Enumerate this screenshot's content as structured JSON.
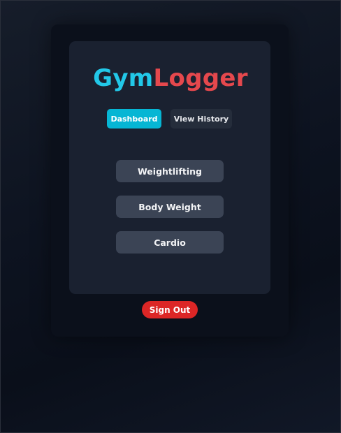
{
  "app": {
    "title_part1": "Gym",
    "title_part2": "Logger"
  },
  "nav": {
    "tabs": [
      {
        "label": "Dashboard",
        "active": true
      },
      {
        "label": "View History",
        "active": false
      }
    ]
  },
  "workouts": {
    "buttons": [
      {
        "label": "Weightlifting"
      },
      {
        "label": "Body Weight"
      },
      {
        "label": "Cardio"
      }
    ]
  },
  "account": {
    "signout_label": "Sign Out"
  },
  "colors": {
    "accent_cyan": "#06b6d4",
    "title_cyan": "#22c8e8",
    "title_red": "#e5484d",
    "signout_red": "#dc2626",
    "card_bg": "#1a2130",
    "button_bg": "#3b4455"
  }
}
